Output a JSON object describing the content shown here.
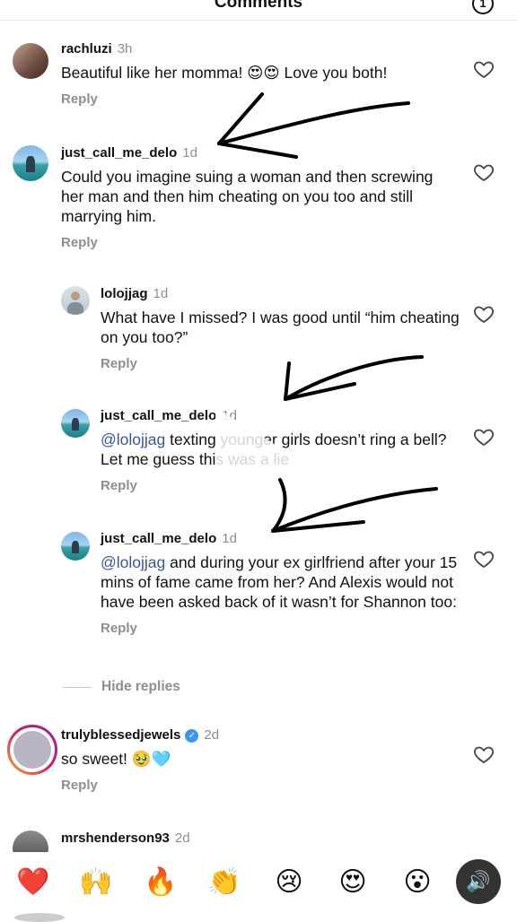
{
  "header": {
    "title": "Comments",
    "badge": "1"
  },
  "comments": [
    {
      "username": "rachluzi",
      "time": "3h",
      "text": "Beautiful like her momma! 😍😍 Love you both!",
      "reply": "Reply"
    },
    {
      "username": "just_call_me_delo",
      "time": "1d",
      "text": "Could you imagine suing a woman and then screwing her man and then him cheating on you too and still marrying him.",
      "reply": "Reply"
    },
    {
      "username": "lolojjag",
      "time": "1d",
      "text": "What have I missed? I was good until “him cheating on you too?”",
      "reply": "Reply"
    },
    {
      "username": "just_call_me_delo",
      "time": "1d",
      "mention": "@lolojjag",
      "text": " texting younger girls doesn’t ring a bell? Let me guess this was a lie",
      "reply": "Reply"
    },
    {
      "username": "just_call_me_delo",
      "time": "1d",
      "mention": "@lolojjag",
      "text": " and during your ex girlfriend after your 15 mins of fame came from her? And Alexis would not have been asked back of it wasn’t for Shannon too:",
      "reply": "Reply"
    },
    {
      "username": "trulyblessedjewels",
      "time": "2d",
      "text": "so sweet! 🥹🩵",
      "reply": "Reply",
      "verified": "✓"
    },
    {
      "username": "mrshenderson93",
      "time": "2d"
    }
  ],
  "hide_replies": "Hide replies",
  "reactions": [
    "❤️",
    "🙌",
    "🔥",
    "👏",
    "😢",
    "😍",
    "😮"
  ],
  "sound_icon": "🔊",
  "colors": {
    "link": "#385898",
    "muted": "#8e8e8e",
    "verified": "#3897f0"
  }
}
